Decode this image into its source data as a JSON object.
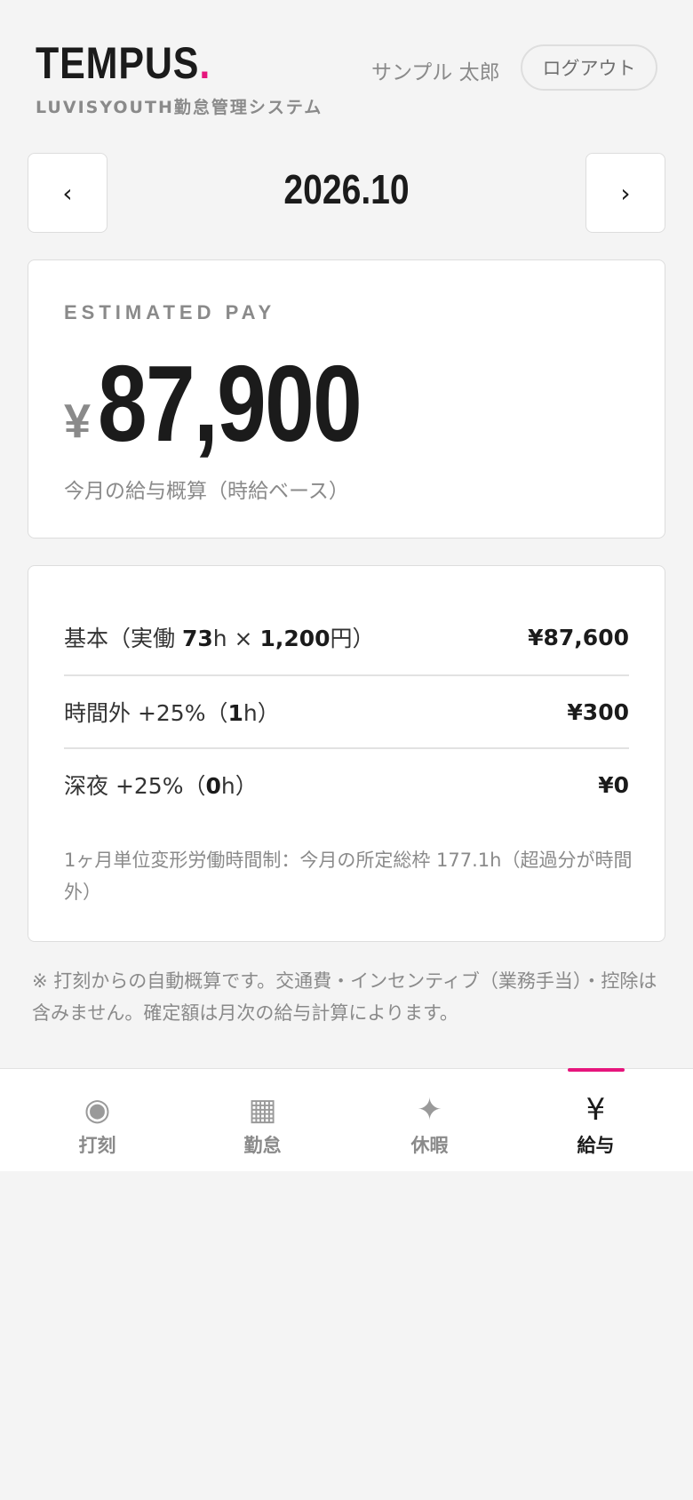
{
  "header": {
    "brand": "TEMPUS",
    "brand_dot": ".",
    "subtitle": "LUVISYOUTH勤怠管理システム",
    "user_name": "サンプル 太郎",
    "logout_label": "ログアウト"
  },
  "month_nav": {
    "prev_label": "‹",
    "next_label": "›",
    "month": "2026.10"
  },
  "pay_card": {
    "label": "ESTIMATED PAY",
    "currency": "¥",
    "amount": "87,900",
    "note": "今月の給与概算（時給ベース）"
  },
  "breakdown": {
    "rows": [
      {
        "label_prefix": "基本（実働 ",
        "hours": "73",
        "label_mid": "h × ",
        "rate": "1,200",
        "label_suffix": "円）",
        "amount": "¥87,600"
      },
      {
        "label_prefix": "時間外 +25%（",
        "hours": "1",
        "label_suffix": "h）",
        "amount": "¥300"
      },
      {
        "label_prefix": "深夜 +25%（",
        "hours": "0",
        "label_suffix": "h）",
        "amount": "¥0"
      }
    ],
    "note": "1ヶ月単位変形労働時間制：今月の所定総枠 177.1h（超過分が時間外）"
  },
  "footnote": "※ 打刻からの自動概算です。交通費・インセンティブ（業務手当）・控除は含みません。確定額は月次の給与計算によります。",
  "tabs": [
    {
      "label": "打刻",
      "icon": "◉",
      "icon_name": "clock-in-icon"
    },
    {
      "label": "勤怠",
      "icon": "▦",
      "icon_name": "calendar-grid-icon"
    },
    {
      "label": "休暇",
      "icon": "✦",
      "icon_name": "sparkle-icon"
    },
    {
      "label": "給与",
      "icon": "¥",
      "icon_name": "yen-icon"
    }
  ],
  "active_tab": "給与",
  "colors": {
    "accent": "#e6157c",
    "muted": "#8a8a8a",
    "text": "#1b1b1b"
  }
}
